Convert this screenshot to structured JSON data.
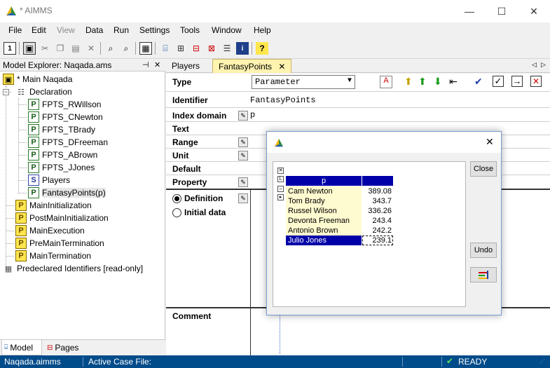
{
  "window": {
    "title": "* AIMMS",
    "minimize_glyph": "—",
    "maximize_glyph": "☐",
    "close_glyph": "✕"
  },
  "menu": [
    "File",
    "Edit",
    "View",
    "Data",
    "Run",
    "Settings",
    "Tools",
    "Window",
    "Help"
  ],
  "left_panel": {
    "title": "Model Explorer: Naqada.ams",
    "pin_glyph": "⊣",
    "close_glyph": "✕",
    "tree": {
      "root": "* Main Naqada",
      "declaration": "Declaration",
      "items": [
        {
          "label": "FPTS_RWillson",
          "kind": "P"
        },
        {
          "label": "FPTS_CNewton",
          "kind": "P"
        },
        {
          "label": "FPTS_TBrady",
          "kind": "P"
        },
        {
          "label": "FPTS_DFreeman",
          "kind": "P"
        },
        {
          "label": "FPTS_ABrown",
          "kind": "P"
        },
        {
          "label": "FPTS_JJones",
          "kind": "P"
        },
        {
          "label": "Players",
          "kind": "S"
        },
        {
          "label": "FantasyPoints(p)",
          "kind": "P"
        }
      ],
      "procedures": [
        "MainInitialization",
        "PostMainInitialization",
        "MainExecution",
        "PreMainTermination",
        "MainTermination"
      ],
      "predeclared": "Predeclared Identifiers [read-only]"
    },
    "tabs": {
      "model": "Model",
      "pages": "Pages"
    }
  },
  "right_panel": {
    "tabs": [
      {
        "label": "Players"
      },
      {
        "label": "FantasyPoints"
      }
    ],
    "tab_close_glyph": "✕",
    "nav_glyphs": {
      "prev": "◁",
      "next": "▷"
    },
    "form": {
      "type_label": "Type",
      "type_value": "Parameter",
      "identifier_label": "Identifier",
      "identifier_value": "FantasyPoints",
      "index_domain_label": "Index domain",
      "index_domain_value": "p",
      "text_label": "Text",
      "range_label": "Range",
      "unit_label": "Unit",
      "default_label": "Default",
      "property_label": "Property",
      "definition_label": "Definition",
      "initial_data_label": "Initial data",
      "comment_label": "Comment"
    }
  },
  "dialog": {
    "header_index": "p",
    "rows": [
      {
        "name": "Cam Newton",
        "value": "389.08"
      },
      {
        "name": "Tom Brady",
        "value": "343.7"
      },
      {
        "name": "Russel Wilson",
        "value": "336.26"
      },
      {
        "name": "Devonta Freeman",
        "value": "243.4"
      },
      {
        "name": "Antonio Brown",
        "value": "242.2"
      },
      {
        "name": "Julio Jones",
        "value": "239.1"
      }
    ],
    "close_label": "Close",
    "undo_label": "Undo",
    "close_glyph": "✕"
  },
  "statusbar": {
    "project": "Naqada.aimms",
    "case": "Active Case File:",
    "state": "READY"
  },
  "colors": {
    "status_bg": "#004b8a",
    "tab_active_bg": "#fff3b0",
    "grid_header": "#0000a8",
    "grid_row": "#fffbd0"
  }
}
